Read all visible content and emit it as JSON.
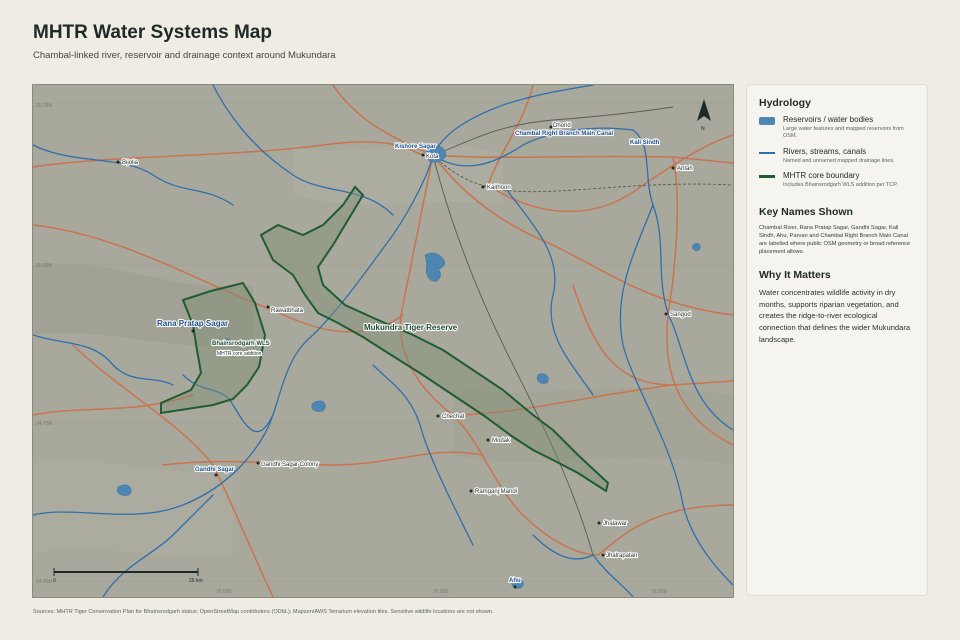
{
  "header": {
    "title": "MHTR Water Systems Map",
    "subtitle": "Chambal-linked river, reservoir and drainage context around Mukundara"
  },
  "map": {
    "places": [
      {
        "name": "Bijolia",
        "type": "town"
      },
      {
        "name": "Kishore Sagar",
        "type": "water"
      },
      {
        "name": "Kota",
        "type": "town"
      },
      {
        "name": "Dhorid",
        "type": "town"
      },
      {
        "name": "Chambal Right Branch Main Canal",
        "type": "water"
      },
      {
        "name": "Kali Sindh",
        "type": "water"
      },
      {
        "name": "Antah",
        "type": "town"
      },
      {
        "name": "Kaithoon",
        "type": "town"
      },
      {
        "name": "Rawatbhata",
        "type": "town"
      },
      {
        "name": "Rana Pratap Sagar",
        "type": "water-major"
      },
      {
        "name": "Bhainsrodgarh WLS",
        "type": "wls"
      },
      {
        "name": "Mukundra Tiger Reserve",
        "type": "core"
      },
      {
        "name": "Sangod",
        "type": "town"
      },
      {
        "name": "Chechat",
        "type": "town"
      },
      {
        "name": "Modak",
        "type": "town"
      },
      {
        "name": "Gandhi Sagar",
        "type": "water"
      },
      {
        "name": "Gandhi Sagar Colony",
        "type": "town"
      },
      {
        "name": "Ramganj Mandi",
        "type": "town"
      },
      {
        "name": "Jhalawar",
        "type": "town"
      },
      {
        "name": "Jhalrapatan",
        "type": "town"
      },
      {
        "name": "Ahu",
        "type": "water"
      }
    ],
    "wls_note": "MHTR core addition",
    "north_label": "N",
    "scale": {
      "start_label": "0",
      "end_label": "25 km"
    },
    "lat_labels": [
      "25.25N",
      "25.00N",
      "24.75N",
      "24.50N"
    ],
    "lon_labels": [
      "75.50E",
      "76.00E",
      "76.50E"
    ]
  },
  "legend": {
    "heading": "Hydrology",
    "items": [
      {
        "name": "Reservoirs / water bodies",
        "desc": "Large water features and mapped reservoirs from OSM.",
        "color": "#4d86b3"
      },
      {
        "name": "Rivers, streams, canals",
        "desc": "Named and unnamed mapped drainage lines.",
        "color": "#2f6fad"
      },
      {
        "name": "MHTR core boundary",
        "desc": "Includes Bhainsrodgarh WLS addition per TCP.",
        "color": "#1f5c33"
      }
    ]
  },
  "key_names": {
    "heading": "Key Names Shown",
    "text": "Chambal River, Rana Pratap Sagar, Gandhi Sagar, Kali Sindh, Ahu, Parvan and Chambal Right Branch Main Canal are labelled where public OSM geometry or broad reference placement allows."
  },
  "why": {
    "heading": "Why It Matters",
    "text": "Water concentrates wildlife activity in dry months, supports riparian vegetation, and creates the ridge-to-river ecological connection that defines the wider Mukundara landscape."
  },
  "sources": "Sources: MHTR Tiger Conservation Plan for Bhainsrodgarh status; OpenStreetMap contributors (ODbL); Mapzen/AWS Terrarium elevation tiles. Sensitive wildlife locations are not shown."
}
